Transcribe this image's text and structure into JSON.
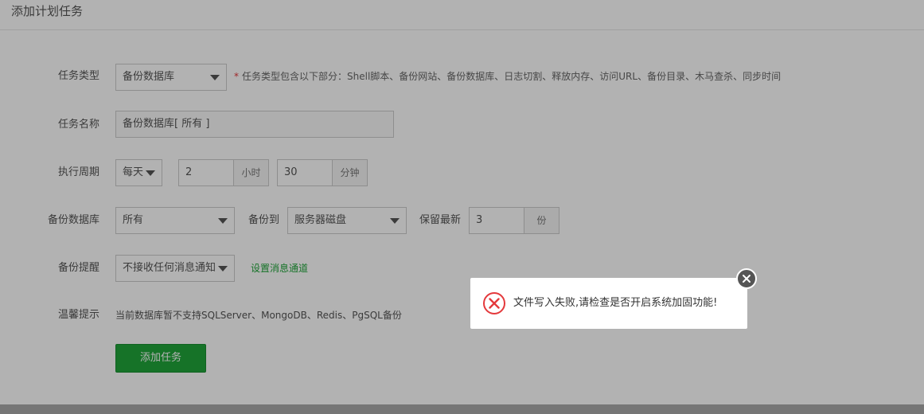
{
  "page": {
    "title": "添加计划任务"
  },
  "form": {
    "task_type": {
      "label": "任务类型",
      "value": "备份数据库",
      "hint_marker": "*",
      "hint": "任务类型包含以下部分：Shell脚本、备份网站、备份数据库、日志切割、释放内存、访问URL、备份目录、木马查杀、同步时间"
    },
    "task_name": {
      "label": "任务名称",
      "value": "备份数据库[ 所有 ]"
    },
    "cycle": {
      "label": "执行周期",
      "period": "每天",
      "hour": "2",
      "hour_unit": "小时",
      "minute": "30",
      "minute_unit": "分钟"
    },
    "backup_db": {
      "label": "备份数据库",
      "value": "所有",
      "backup_to_label": "备份到",
      "backup_to": "服务器磁盘",
      "keep_label": "保留最新",
      "keep_value": "3",
      "keep_unit": "份"
    },
    "notify": {
      "label": "备份提醒",
      "value": "不接收任何消息通知",
      "link": "设置消息通道"
    },
    "tips": {
      "label": "温馨提示",
      "text": "当前数据库暂不支持SQLServer、MongoDB、Redis、PgSQL备份"
    },
    "submit_label": "添加任务"
  },
  "toast": {
    "icon": "error-circle-icon",
    "message": "文件写入失败,请检查是否开启系统加固功能!",
    "close_icon": "close-icon"
  },
  "colors": {
    "accent": "#20a53a",
    "error": "#e4393c",
    "required_marker": "#e4393c"
  }
}
